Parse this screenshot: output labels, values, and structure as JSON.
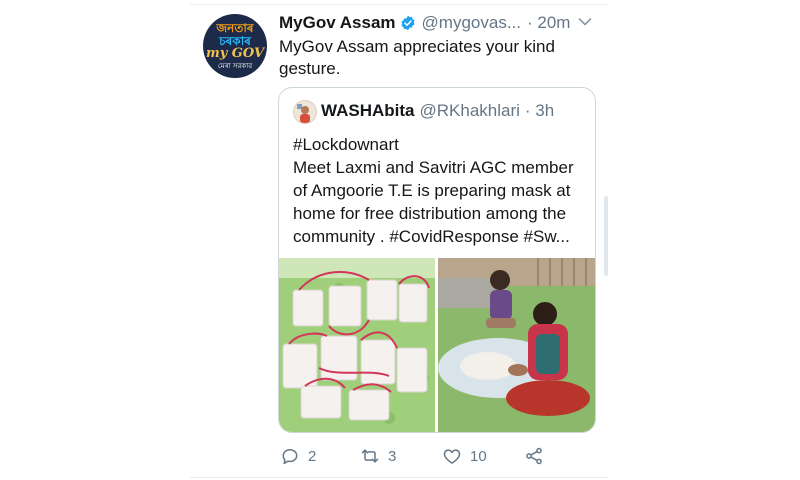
{
  "tweet": {
    "author_name": "MyGov Assam",
    "handle": "@mygovas...",
    "time": "· 20m",
    "text": "MyGov Assam appreciates your kind gesture.",
    "avatar_lines": [
      "জনতাৰ",
      "চৰকাৰ",
      "my GOV",
      "মেৰা সরকার"
    ]
  },
  "quote": {
    "author_name": "WASHAbita",
    "handle": "@RKhakhlari",
    "time": "· 3h",
    "text_lines": [
      "#Lockdownart",
      "Meet Laxmi and Savitri AGC member",
      "of Amgoorie T.E is preparing mask at",
      "home for free distribution among the",
      "community . #CovidResponse #Sw..."
    ]
  },
  "actions": {
    "reply_count": "2",
    "retweet_count": "3",
    "like_count": "10"
  },
  "icons": {
    "verified": "verified-badge-icon",
    "menu": "chevron-down-icon",
    "reply": "reply-icon",
    "retweet": "retweet-icon",
    "like": "heart-icon",
    "share": "share-icon"
  },
  "colors": {
    "verified": "#1da1f2",
    "muted": "#657786",
    "text": "#14171a",
    "border": "#ccd6dd"
  }
}
